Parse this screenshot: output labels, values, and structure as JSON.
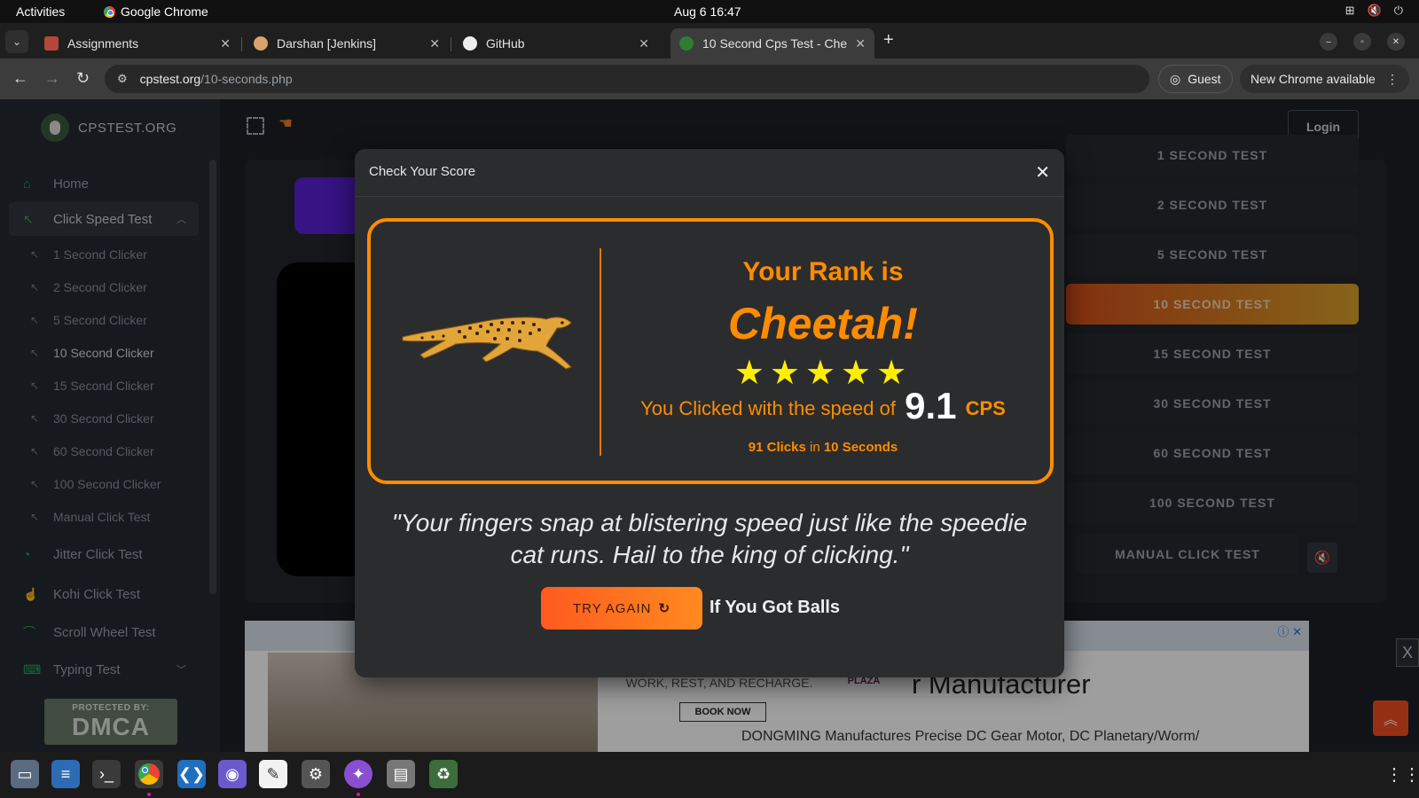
{
  "system": {
    "activities": "Activities",
    "app_name": "Google Chrome",
    "clock": "Aug 6  16:47"
  },
  "browser": {
    "tabs": [
      {
        "title": "Assignments",
        "active": false
      },
      {
        "title": "Darshan [Jenkins]",
        "active": false
      },
      {
        "title": "GitHub",
        "active": false
      },
      {
        "title": "10 Second Cps Test - Che",
        "active": true
      }
    ],
    "url_host": "cpstest.org",
    "url_path": "/10-seconds.php",
    "guest_label": "Guest",
    "update_label": "New Chrome available"
  },
  "site": {
    "brand": "CPSTEST.ORG",
    "login": "Login",
    "sidebar": {
      "home": "Home",
      "click_speed_group": "Click Speed Test",
      "sub_items": [
        "1 Second Clicker",
        "2 Second Clicker",
        "5 Second Clicker",
        "10 Second Clicker",
        "15 Second Clicker",
        "30 Second Clicker",
        "60 Second Clicker",
        "100 Second Clicker",
        "Manual Click Test"
      ],
      "current_sub_item": "10 Second Clicker",
      "jitter": "Jitter Click Test",
      "kohi": "Kohi Click Test",
      "scroll": "Scroll Wheel Test",
      "typing": "Typing Test",
      "dmca_small": "PROTECTED BY:",
      "dmca_big": "DMCA"
    },
    "test_buttons": [
      "1 SECOND TEST",
      "2 SECOND TEST",
      "5 SECOND TEST",
      "10 SECOND TEST",
      "15 SECOND TEST",
      "30 SECOND TEST",
      "60 SECOND TEST",
      "100 SECOND TEST"
    ],
    "active_test": "10 SECOND TEST",
    "manual_test": "MANUAL CLICK TEST",
    "ad": {
      "hotel_copy": "SPACE DESIGNED TO HELP YOU WORK, REST, AND RECHARGE.",
      "book_now": "BOOK NOW",
      "hotel_name": "CROWNE PLAZA",
      "headline": "r Manufacturer",
      "subline": "DONGMING Manufactures Precise DC Gear Motor, DC Planetary/Worm/"
    },
    "ad_close": "X"
  },
  "modal": {
    "title": "Check Your Score",
    "rank_label": "Your Rank is",
    "rank_name": "Cheetah!",
    "stars": "★★★★★",
    "speed_prefix": "You Clicked with the speed of",
    "cps_value": "9.1",
    "cps_unit": "CPS",
    "clicks": "91 Clicks",
    "clicks_in": "in",
    "duration": "10 Seconds",
    "quote": "\"Your fingers snap at blistering speed just like the speedie cat runs. Hail to the king of clicking.\"",
    "try_again": "TRY AGAIN",
    "dare": "If You Got Balls"
  },
  "colors": {
    "accent_orange": "#ff8c00",
    "star_yellow": "#ffee00",
    "active_test_from": "#d34d1a",
    "active_test_to": "#d9a12a"
  }
}
